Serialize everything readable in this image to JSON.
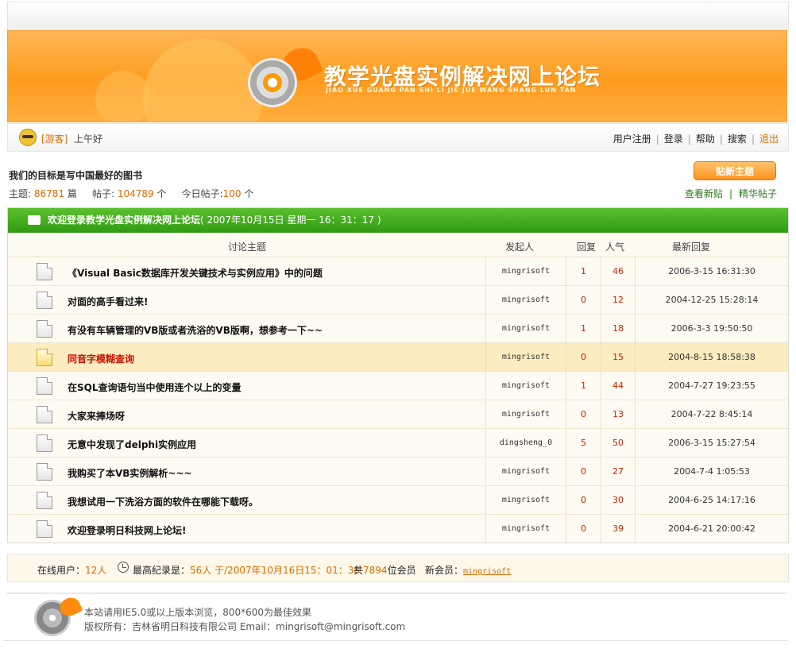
{
  "banner": {
    "title": "教学光盘实例解决网上论坛",
    "subtitle": "JIAO XUE GUANG PAN SHI LI JIE JUE WANG SHANG LUN TAN"
  },
  "userbar": {
    "guest_label": "[游客]",
    "greeting": "上午好",
    "nav": {
      "register": "用户注册",
      "login": "登录",
      "help": "帮助",
      "search": "搜索",
      "logout": "退出"
    },
    "separator": "|"
  },
  "board": {
    "slogan": "我们的目标是写中国最好的图书",
    "topics_label": "主题:",
    "topics_count": "86781",
    "topics_unit": "篇",
    "posts_label": "帖子:",
    "posts_count": "104789",
    "posts_unit": "个",
    "today_label": "今日帖子:",
    "today_count": "100",
    "today_unit": "个",
    "new_topic_button": "贴新主题",
    "view_new": "查看新贴",
    "link_separator": "|",
    "featured": "精华帖子"
  },
  "forum": {
    "welcome": "欢迎登录教学光盘实例解决网上论坛",
    "datetime": "( 2007年10月15日 星期一 16：31：17 )",
    "columns": {
      "topic": "讨论主题",
      "author": "发起人",
      "replies": "回复",
      "views": "人气",
      "last": "最新回复"
    },
    "rows": [
      {
        "topic": "《Visual Basic数据库开发关键技术与实例应用》中的问题",
        "author": "mingrisoft",
        "replies": "1",
        "views": "46",
        "last": "2006-3-15 16:31:30"
      },
      {
        "topic": "对面的高手看过来!",
        "author": "mingrisoft",
        "replies": "0",
        "views": "12",
        "last": "2004-12-25 15:28:14"
      },
      {
        "topic": "有没有车辆管理的VB版或者洗浴的VB版啊，想参考一下~~",
        "author": "mingrisoft",
        "replies": "1",
        "views": "18",
        "last": "2006-3-3 19:50:50"
      },
      {
        "topic": "同音字模糊查询",
        "author": "mingrisoft",
        "replies": "0",
        "views": "15",
        "last": "2004-8-15 18:58:38"
      },
      {
        "topic": "在SQL查询语句当中使用连个以上的变量",
        "author": "mingrisoft",
        "replies": "1",
        "views": "44",
        "last": "2004-7-27 19:23:55"
      },
      {
        "topic": "大家来捧场呀",
        "author": "mingrisoft",
        "replies": "0",
        "views": "13",
        "last": "2004-7-22 8:45:14"
      },
      {
        "topic": "无意中发现了delphi实例应用",
        "author": "dingsheng_0",
        "replies": "5",
        "views": "50",
        "last": "2006-3-15 15:27:54"
      },
      {
        "topic": "我购买了本VB实例解析~~~",
        "author": "mingrisoft",
        "replies": "0",
        "views": "27",
        "last": "2004-7-4 1:05:53"
      },
      {
        "topic": "我想试用一下洗浴方面的软件在哪能下载呀。",
        "author": "mingrisoft",
        "replies": "0",
        "views": "30",
        "last": "2004-6-25 14:17:16"
      },
      {
        "topic": "欢迎登录明日科技网上论坛!",
        "author": "mingrisoft",
        "replies": "0",
        "views": "39",
        "last": "2004-6-21 20:00:42"
      }
    ]
  },
  "online": {
    "label": "在线用户：",
    "count": "12人",
    "record_label": "最高纪录是：",
    "record_value": "56人 于/2007年10月16日15：01：38",
    "members_prefix": "共",
    "members_count": "7894",
    "members_suffix": "位会员",
    "newest_label": "新会员：",
    "newest_name": "mingrisoft"
  },
  "footer": {
    "line1": "本站请用IE5.0或以上版本浏览，800*600为最佳效果",
    "line2": "版权所有：吉林省明日科技有限公司 Email：mingrisoft@mingrisoft.com"
  }
}
